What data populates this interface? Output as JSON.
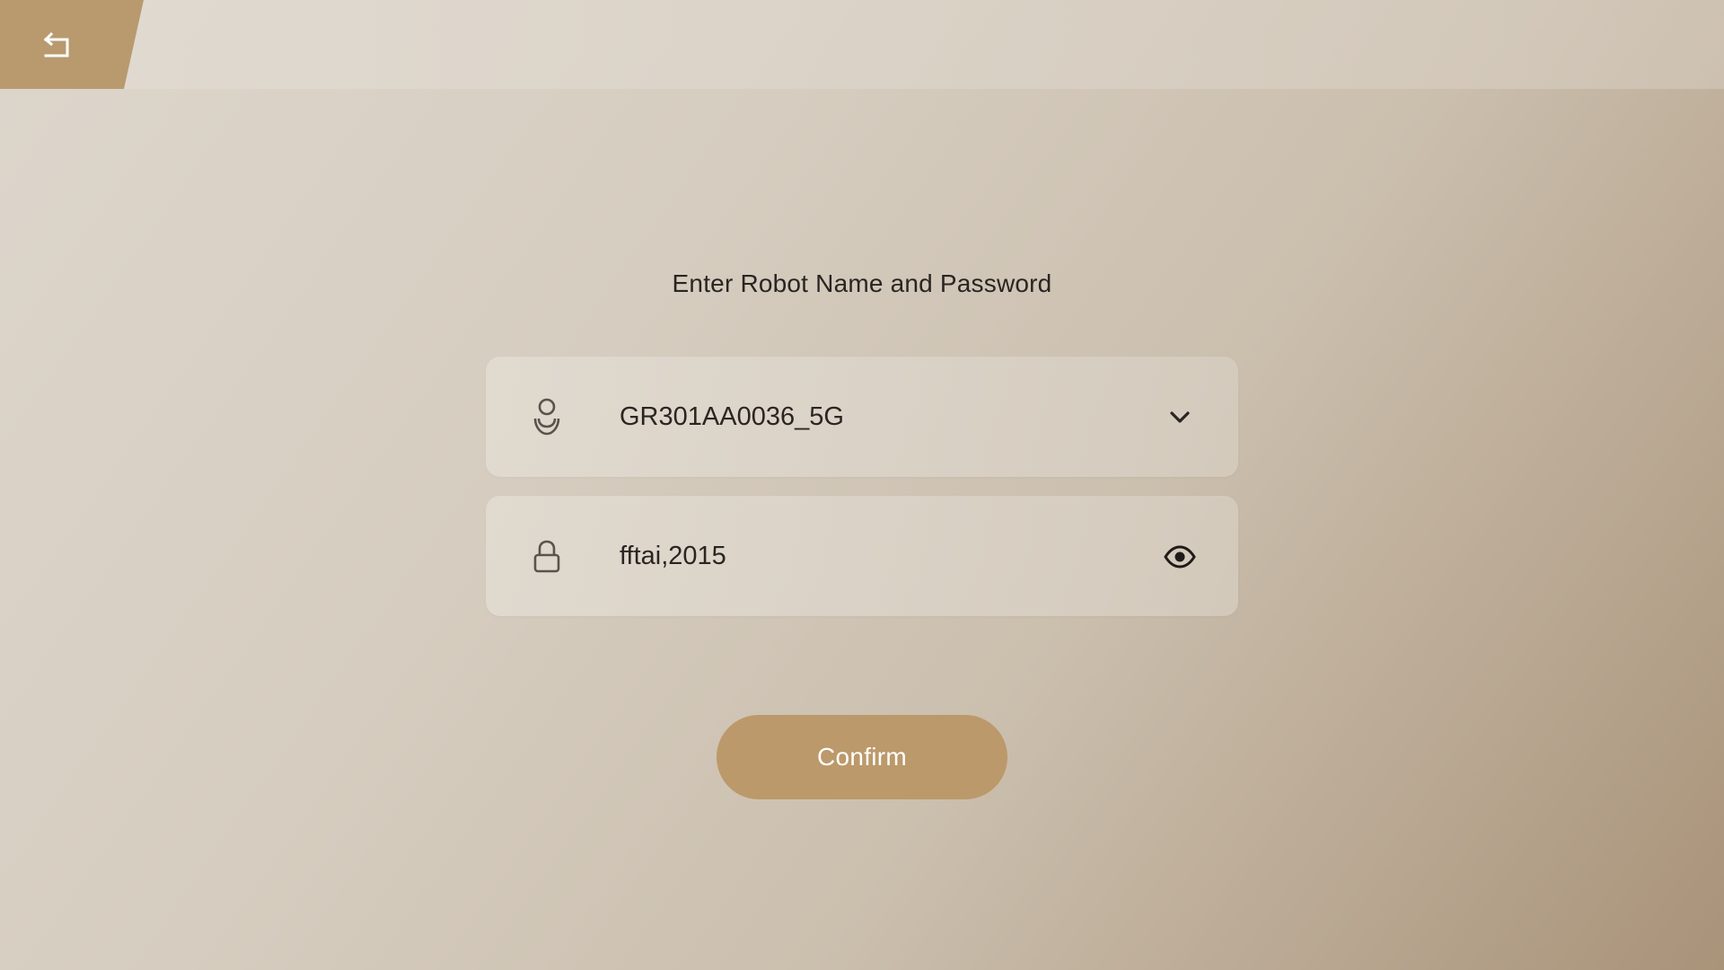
{
  "header": {
    "back_icon": "back-arrow-icon"
  },
  "form": {
    "title": "Enter Robot Name and Password",
    "robot_name": {
      "value": "GR301AA0036_5G",
      "lead_icon": "robot-icon",
      "trail_icon": "chevron-down-icon"
    },
    "password": {
      "value": "fftai,2015",
      "lead_icon": "lock-icon",
      "trail_icon": "eye-icon"
    },
    "confirm_label": "Confirm"
  },
  "colors": {
    "accent": "#bb996a",
    "back_tab": "#b89a6e",
    "text": "#2a2522"
  }
}
